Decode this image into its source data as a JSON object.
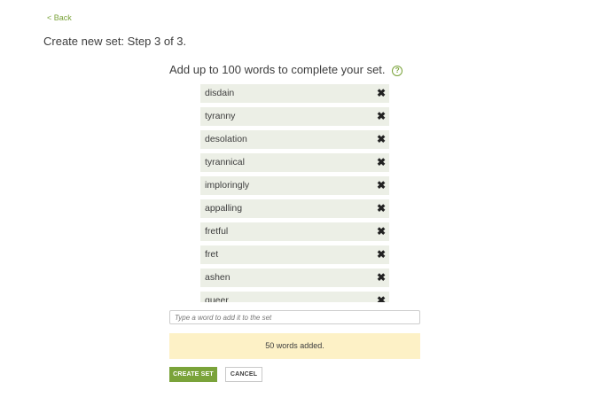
{
  "nav": {
    "back_label": "< Back"
  },
  "page": {
    "title": "Create new set: Step 3 of 3.",
    "instructions": "Add up to 100 words to complete your set.",
    "help_icon": "question-circle-icon"
  },
  "words": [
    "disdain",
    "tyranny",
    "desolation",
    "tyrannical",
    "imploringly",
    "appalling",
    "fretful",
    "fret",
    "ashen",
    "queer"
  ],
  "remove_icon": "close-x-icon",
  "word_input": {
    "placeholder": "Type a word to add it to the set",
    "value": ""
  },
  "status": {
    "message": "50 words added."
  },
  "buttons": {
    "create_label": "CREATE SET",
    "cancel_label": "CANCEL"
  },
  "colors": {
    "accent": "#7aa33a",
    "word_bg": "#ecefe6",
    "status_bg": "#fdf1c6"
  }
}
